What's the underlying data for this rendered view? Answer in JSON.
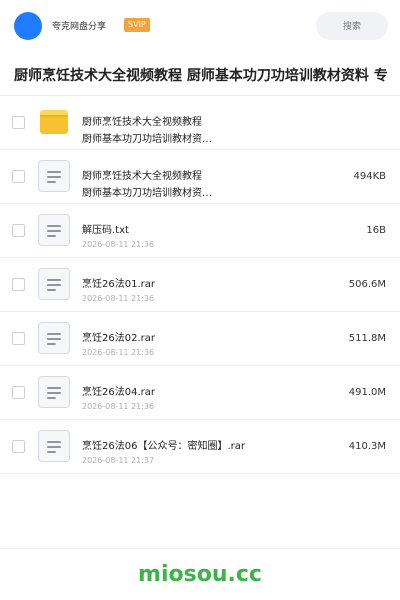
{
  "header": {
    "user_name": "夸克网盘分享",
    "badge": "SVIP",
    "search_placeholder": "搜索",
    "colors": {
      "avatar": "#1f7bff",
      "badge": "#f4a43a"
    }
  },
  "page_title": "厨师烹饪技术大全视频教程 厨师基本功刀功培训教材资料 专",
  "files": [
    {
      "icon": "folder-icon",
      "name": "厨师烹饪技术大全视频教程",
      "name_line2": "厨师基本功刀功培训教材资…",
      "date": "",
      "size": ""
    },
    {
      "icon": "document-icon",
      "name": "厨师烹饪技术大全视频教程",
      "name_line2": "厨师基本功刀功培训教材资…",
      "date": "",
      "size": "494KB"
    },
    {
      "icon": "document-icon",
      "name": "解压码.txt",
      "name_line2": "",
      "date": "2026-08-11 21:36",
      "size": "16B"
    },
    {
      "icon": "document-icon",
      "name": "烹饪26法01.rar",
      "name_line2": "",
      "date": "2026-08-11 21:36",
      "size": "506.6M"
    },
    {
      "icon": "document-icon",
      "name": "烹饪26法02.rar",
      "name_line2": "",
      "date": "2026-08-11 21:36",
      "size": "511.8M"
    },
    {
      "icon": "document-icon",
      "name": "烹饪26法04.rar",
      "name_line2": "",
      "date": "2026-08-11 21:36",
      "size": "491.0M"
    },
    {
      "icon": "document-icon",
      "name": "烹饪26法06【公众号：密知圈】.rar",
      "name_line2": "",
      "date": "2026-08-11 21:37",
      "size": "410.3M"
    }
  ],
  "watermark": "miosou.cc"
}
